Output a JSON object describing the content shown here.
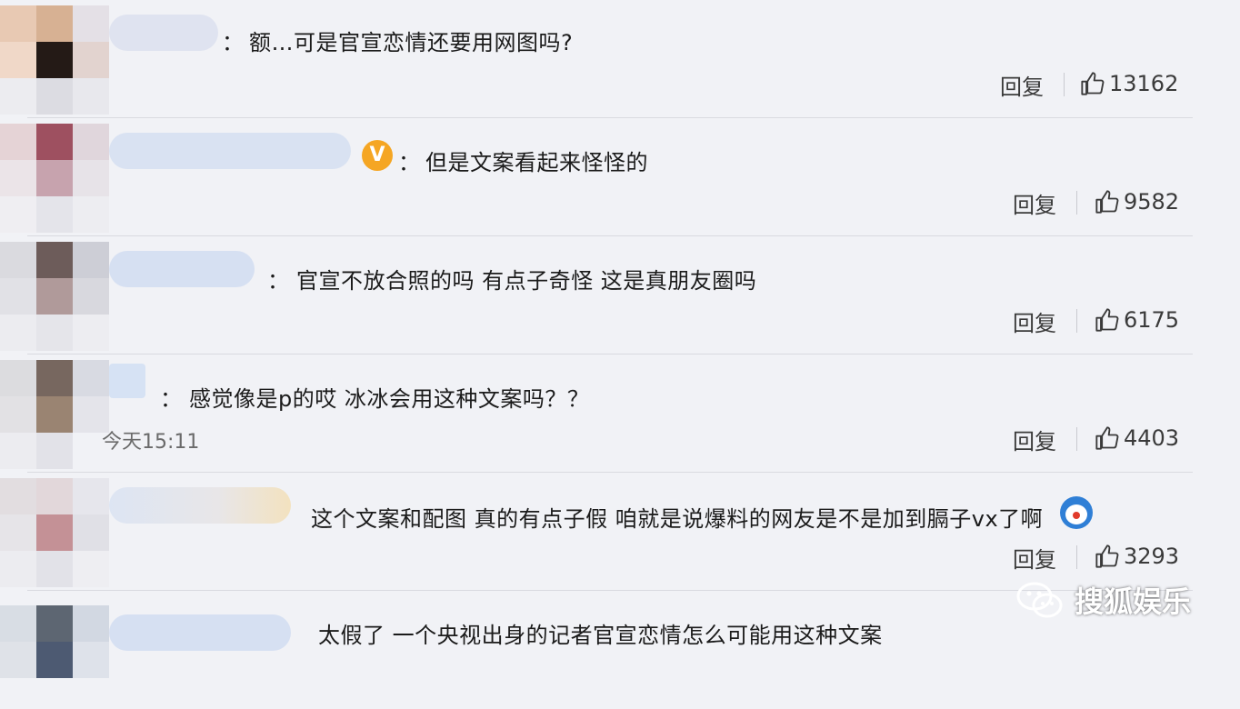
{
  "comments": [
    {
      "text": "额…可是官宣恋情还要用网图吗?",
      "reply": "回复",
      "likes": "13162"
    },
    {
      "text": "但是文案看起来怪怪的",
      "reply": "回复",
      "likes": "9582",
      "badge": "V"
    },
    {
      "text": "官宣不放合照的吗 有点子奇怪 这是真朋友圈吗",
      "reply": "回复",
      "likes": "6175"
    },
    {
      "text": "感觉像是p的哎 冰冰会用这种文案吗？？",
      "reply": "回复",
      "likes": "4403",
      "time": "今天15:11"
    },
    {
      "text": "这个文案和配图 真的有点子假 咱就是说爆料的网友是不是加到膈子vx了啊",
      "reply": "回复",
      "likes": "3293",
      "emoji": "doraemon-emoji"
    },
    {
      "text": "太假了 一个央视出身的记者官宣恋情怎么可能用这种文案"
    }
  ],
  "colon": "：",
  "watermark": {
    "text": "搜狐娱乐",
    "icon": "wechat-icon"
  },
  "icons": {
    "like": "thumbs-up-icon",
    "verified": "v-badge-icon"
  },
  "colors": {
    "background": "#f1f2f6",
    "badge": "#f5a623",
    "text": "#1b1b1b"
  }
}
